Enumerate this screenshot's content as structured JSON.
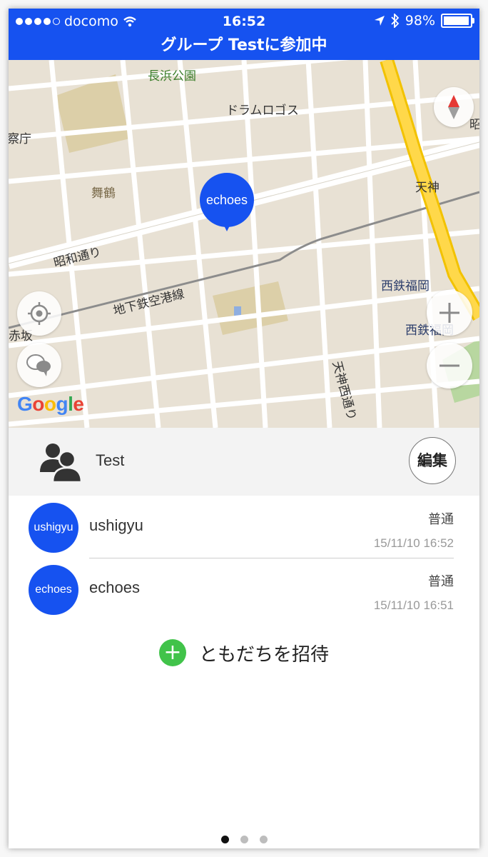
{
  "status_bar": {
    "carrier": "docomo",
    "time": "16:52",
    "battery": "98%"
  },
  "header": {
    "title": "グループ Testに参加中"
  },
  "map": {
    "labels": {
      "park": "長浜公園",
      "drum": "ドラムロゴス",
      "office": "察庁",
      "maizuru": "舞鶴",
      "tenjin": "天神",
      "showa": "昭和通り",
      "subway": "地下鉄空港線",
      "nishitetsu1": "西鉄福岡",
      "nishitetsu2": "西鉄福岡",
      "tenjin_nishi": "天神西通り",
      "akasaka": "赤坂",
      "edge": "昭"
    },
    "marker_label": "echoes",
    "google_logo": [
      "G",
      "o",
      "o",
      "g",
      "l",
      "e"
    ]
  },
  "group": {
    "name": "Test",
    "edit_label": "編集"
  },
  "members": [
    {
      "avatar": "ushigyu",
      "name": "ushigyu",
      "status": "普通",
      "time": "15/11/10 16:52"
    },
    {
      "avatar": "echoes",
      "name": "echoes",
      "status": "普通",
      "time": "15/11/10 16:51"
    }
  ],
  "invite": {
    "icon": "+",
    "label": "ともだちを招待"
  },
  "pager": {
    "pages": 3,
    "current": 1
  }
}
